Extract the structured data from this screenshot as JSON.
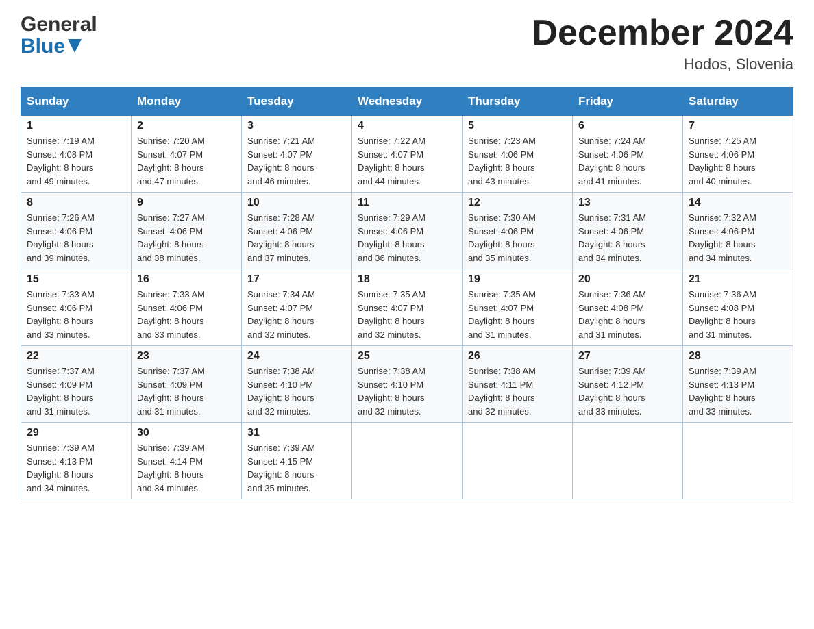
{
  "header": {
    "logo": {
      "general": "General",
      "blue": "Blue"
    },
    "title": "December 2024",
    "location": "Hodos, Slovenia"
  },
  "days_of_week": [
    "Sunday",
    "Monday",
    "Tuesday",
    "Wednesday",
    "Thursday",
    "Friday",
    "Saturday"
  ],
  "weeks": [
    [
      {
        "day": "1",
        "sunrise": "7:19 AM",
        "sunset": "4:08 PM",
        "daylight": "8 hours and 49 minutes."
      },
      {
        "day": "2",
        "sunrise": "7:20 AM",
        "sunset": "4:07 PM",
        "daylight": "8 hours and 47 minutes."
      },
      {
        "day": "3",
        "sunrise": "7:21 AM",
        "sunset": "4:07 PM",
        "daylight": "8 hours and 46 minutes."
      },
      {
        "day": "4",
        "sunrise": "7:22 AM",
        "sunset": "4:07 PM",
        "daylight": "8 hours and 44 minutes."
      },
      {
        "day": "5",
        "sunrise": "7:23 AM",
        "sunset": "4:06 PM",
        "daylight": "8 hours and 43 minutes."
      },
      {
        "day": "6",
        "sunrise": "7:24 AM",
        "sunset": "4:06 PM",
        "daylight": "8 hours and 41 minutes."
      },
      {
        "day": "7",
        "sunrise": "7:25 AM",
        "sunset": "4:06 PM",
        "daylight": "8 hours and 40 minutes."
      }
    ],
    [
      {
        "day": "8",
        "sunrise": "7:26 AM",
        "sunset": "4:06 PM",
        "daylight": "8 hours and 39 minutes."
      },
      {
        "day": "9",
        "sunrise": "7:27 AM",
        "sunset": "4:06 PM",
        "daylight": "8 hours and 38 minutes."
      },
      {
        "day": "10",
        "sunrise": "7:28 AM",
        "sunset": "4:06 PM",
        "daylight": "8 hours and 37 minutes."
      },
      {
        "day": "11",
        "sunrise": "7:29 AM",
        "sunset": "4:06 PM",
        "daylight": "8 hours and 36 minutes."
      },
      {
        "day": "12",
        "sunrise": "7:30 AM",
        "sunset": "4:06 PM",
        "daylight": "8 hours and 35 minutes."
      },
      {
        "day": "13",
        "sunrise": "7:31 AM",
        "sunset": "4:06 PM",
        "daylight": "8 hours and 34 minutes."
      },
      {
        "day": "14",
        "sunrise": "7:32 AM",
        "sunset": "4:06 PM",
        "daylight": "8 hours and 34 minutes."
      }
    ],
    [
      {
        "day": "15",
        "sunrise": "7:33 AM",
        "sunset": "4:06 PM",
        "daylight": "8 hours and 33 minutes."
      },
      {
        "day": "16",
        "sunrise": "7:33 AM",
        "sunset": "4:06 PM",
        "daylight": "8 hours and 33 minutes."
      },
      {
        "day": "17",
        "sunrise": "7:34 AM",
        "sunset": "4:07 PM",
        "daylight": "8 hours and 32 minutes."
      },
      {
        "day": "18",
        "sunrise": "7:35 AM",
        "sunset": "4:07 PM",
        "daylight": "8 hours and 32 minutes."
      },
      {
        "day": "19",
        "sunrise": "7:35 AM",
        "sunset": "4:07 PM",
        "daylight": "8 hours and 31 minutes."
      },
      {
        "day": "20",
        "sunrise": "7:36 AM",
        "sunset": "4:08 PM",
        "daylight": "8 hours and 31 minutes."
      },
      {
        "day": "21",
        "sunrise": "7:36 AM",
        "sunset": "4:08 PM",
        "daylight": "8 hours and 31 minutes."
      }
    ],
    [
      {
        "day": "22",
        "sunrise": "7:37 AM",
        "sunset": "4:09 PM",
        "daylight": "8 hours and 31 minutes."
      },
      {
        "day": "23",
        "sunrise": "7:37 AM",
        "sunset": "4:09 PM",
        "daylight": "8 hours and 31 minutes."
      },
      {
        "day": "24",
        "sunrise": "7:38 AM",
        "sunset": "4:10 PM",
        "daylight": "8 hours and 32 minutes."
      },
      {
        "day": "25",
        "sunrise": "7:38 AM",
        "sunset": "4:10 PM",
        "daylight": "8 hours and 32 minutes."
      },
      {
        "day": "26",
        "sunrise": "7:38 AM",
        "sunset": "4:11 PM",
        "daylight": "8 hours and 32 minutes."
      },
      {
        "day": "27",
        "sunrise": "7:39 AM",
        "sunset": "4:12 PM",
        "daylight": "8 hours and 33 minutes."
      },
      {
        "day": "28",
        "sunrise": "7:39 AM",
        "sunset": "4:13 PM",
        "daylight": "8 hours and 33 minutes."
      }
    ],
    [
      {
        "day": "29",
        "sunrise": "7:39 AM",
        "sunset": "4:13 PM",
        "daylight": "8 hours and 34 minutes."
      },
      {
        "day": "30",
        "sunrise": "7:39 AM",
        "sunset": "4:14 PM",
        "daylight": "8 hours and 34 minutes."
      },
      {
        "day": "31",
        "sunrise": "7:39 AM",
        "sunset": "4:15 PM",
        "daylight": "8 hours and 35 minutes."
      },
      null,
      null,
      null,
      null
    ]
  ],
  "labels": {
    "sunrise": "Sunrise:",
    "sunset": "Sunset:",
    "daylight": "Daylight:"
  }
}
